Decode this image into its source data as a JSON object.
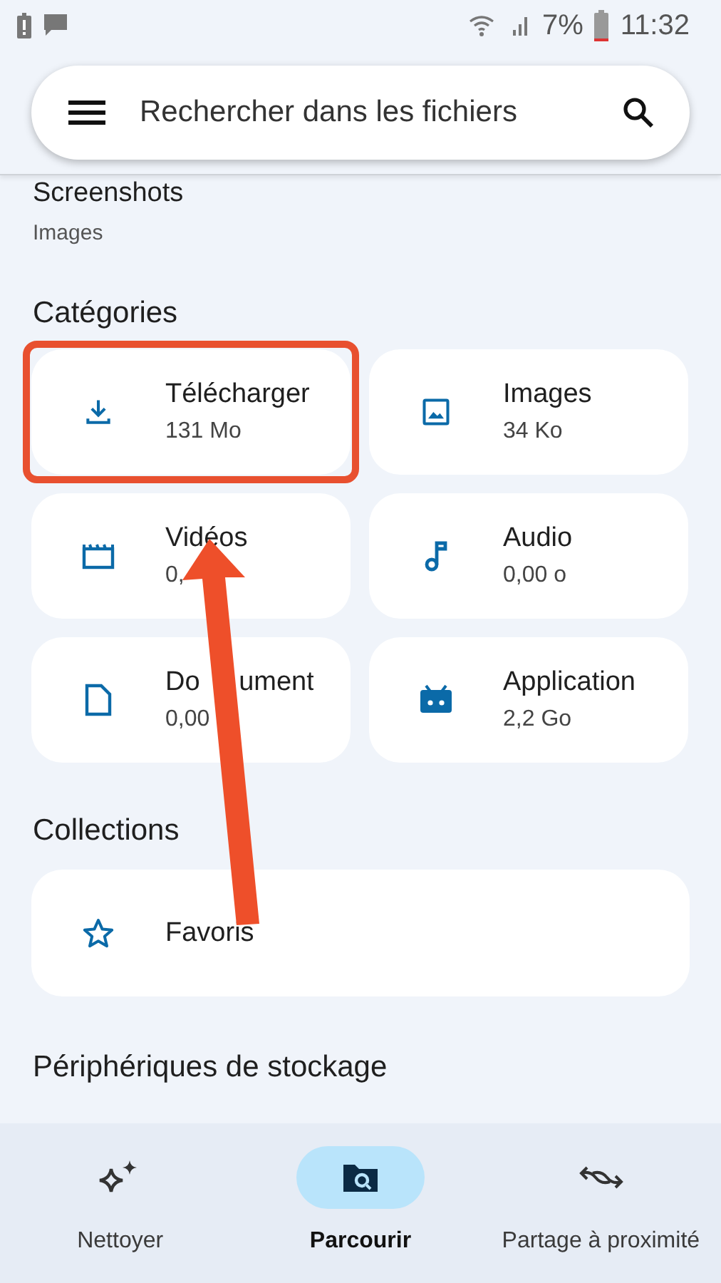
{
  "status_bar": {
    "battery": "7%",
    "time": "11:32"
  },
  "search": {
    "placeholder": "Rechercher dans les fichiers"
  },
  "recent": {
    "title": "Screenshots",
    "subtitle": "Images"
  },
  "categories": {
    "heading": "Catégories",
    "items": [
      {
        "kind": "download",
        "title": "Télécharger",
        "size": "131 Mo",
        "highlighted": true
      },
      {
        "kind": "image",
        "title": "Images",
        "size": "34 Ko",
        "highlighted": false
      },
      {
        "kind": "video",
        "title": "Vidéos",
        "size": "0,",
        "highlighted": false
      },
      {
        "kind": "audio",
        "title": "Audio",
        "size": "0,00 o",
        "highlighted": false
      },
      {
        "kind": "document",
        "title": "Do ument",
        "size": "0,00",
        "highlighted": false
      },
      {
        "kind": "apps",
        "title": "Application",
        "size": "2,2 Go",
        "highlighted": false
      }
    ]
  },
  "collections": {
    "heading": "Collections",
    "items": [
      {
        "kind": "star",
        "title": "Favoris"
      }
    ]
  },
  "storage": {
    "heading": "Périphériques de stockage"
  },
  "nav": [
    {
      "kind": "clean",
      "label": "Nettoyer",
      "selected": false
    },
    {
      "kind": "browse",
      "label": "Parcourir",
      "selected": true
    },
    {
      "kind": "share",
      "label": "Partage à proximité",
      "selected": false
    }
  ]
}
